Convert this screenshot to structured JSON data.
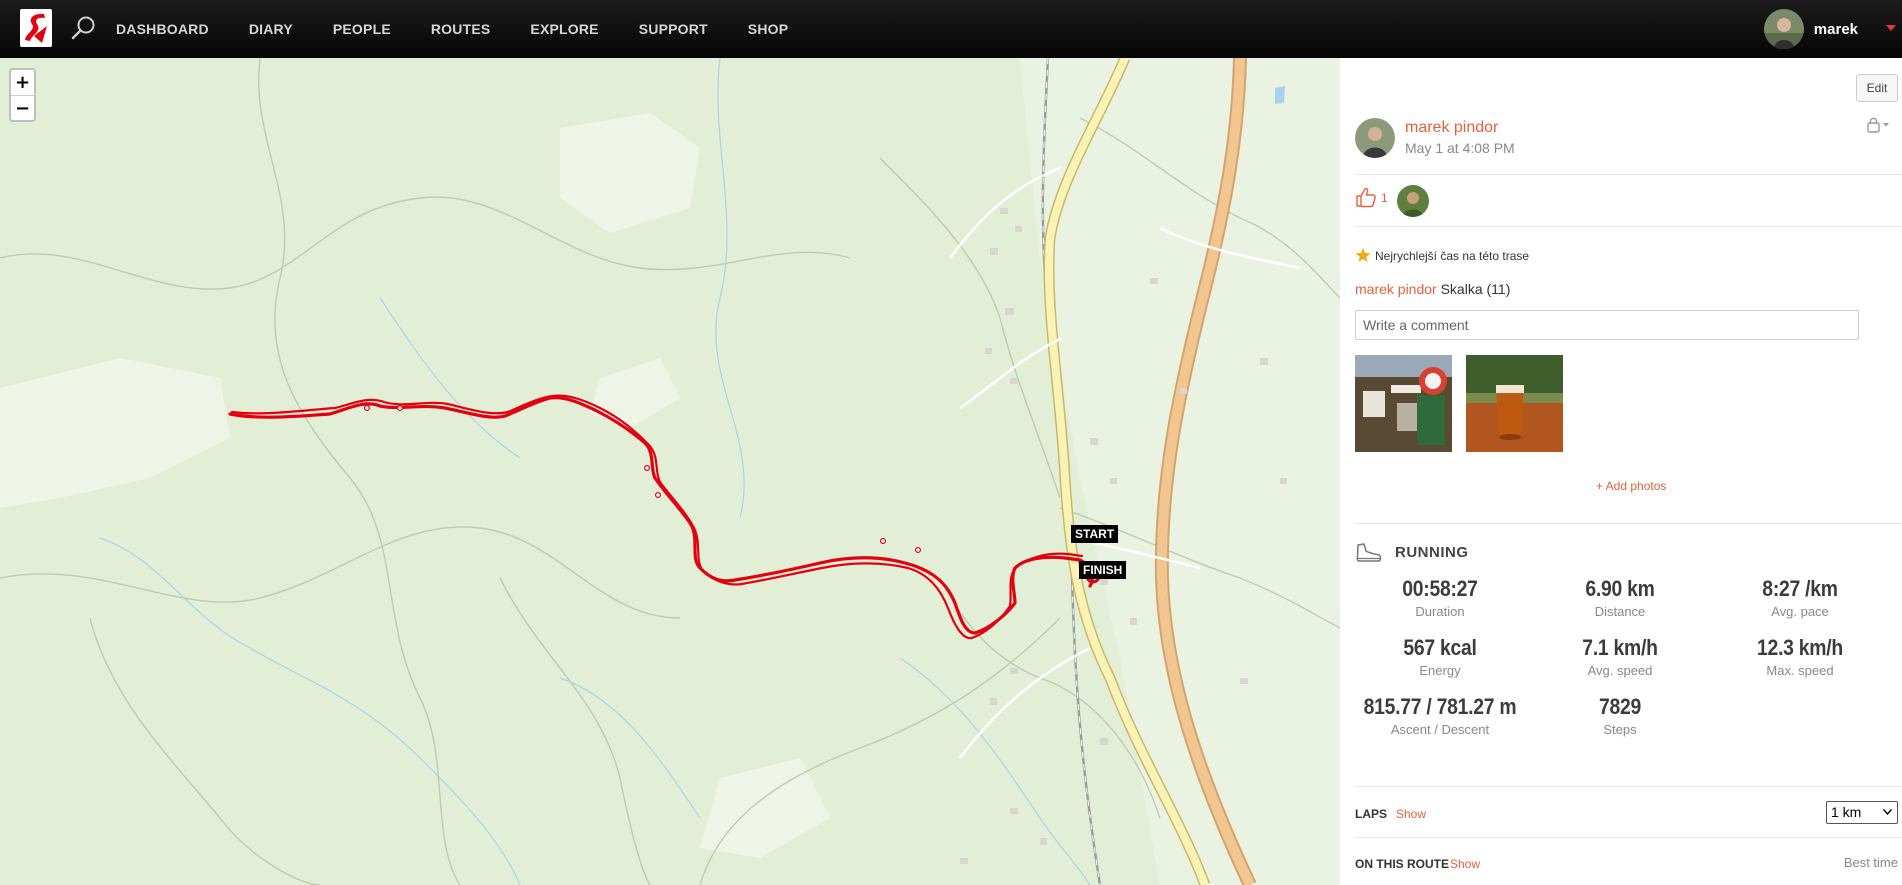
{
  "nav": {
    "items": [
      "DASHBOARD",
      "DIARY",
      "PEOPLE",
      "ROUTES",
      "EXPLORE",
      "SUPPORT",
      "SHOP"
    ],
    "user_name": "marek"
  },
  "map": {
    "zoom_in": "+",
    "zoom_out": "−",
    "start_label": "START",
    "finish_label": "FINISH",
    "track_color": "#e3000f"
  },
  "activity": {
    "edit_label": "Edit",
    "author": "marek pindor",
    "time": "May 1 at 4:08 PM",
    "likes": "1",
    "record_text": "Nejrychlejší čas na této trase",
    "route_author": "marek pindor",
    "route_name": "Skalka (11)",
    "comment_placeholder": "Write a comment",
    "add_photos": "+ Add photos",
    "sport": "RUNNING",
    "stats": [
      {
        "value": "00:58:27",
        "label": "Duration"
      },
      {
        "value": "6.90 km",
        "label": "Distance"
      },
      {
        "value": "8:27 /km",
        "label": "Avg. pace"
      },
      {
        "value": "567 kcal",
        "label": "Energy"
      },
      {
        "value": "7.1 km/h",
        "label": "Avg. speed"
      },
      {
        "value": "12.3 km/h",
        "label": "Max. speed"
      },
      {
        "value": "815.77 / 781.27 m",
        "label": "Ascent / Descent"
      },
      {
        "value": "7829",
        "label": "Steps"
      }
    ],
    "laps_title": "LAPS",
    "laps_show": "Show",
    "laps_interval": "1 km",
    "route_title": "ON THIS ROUTE",
    "route_show": "Show",
    "best_time": "Best time"
  },
  "colors": {
    "accent": "#e8603c",
    "nav_bg": "#111111",
    "map_bg": "#e2efd6"
  }
}
